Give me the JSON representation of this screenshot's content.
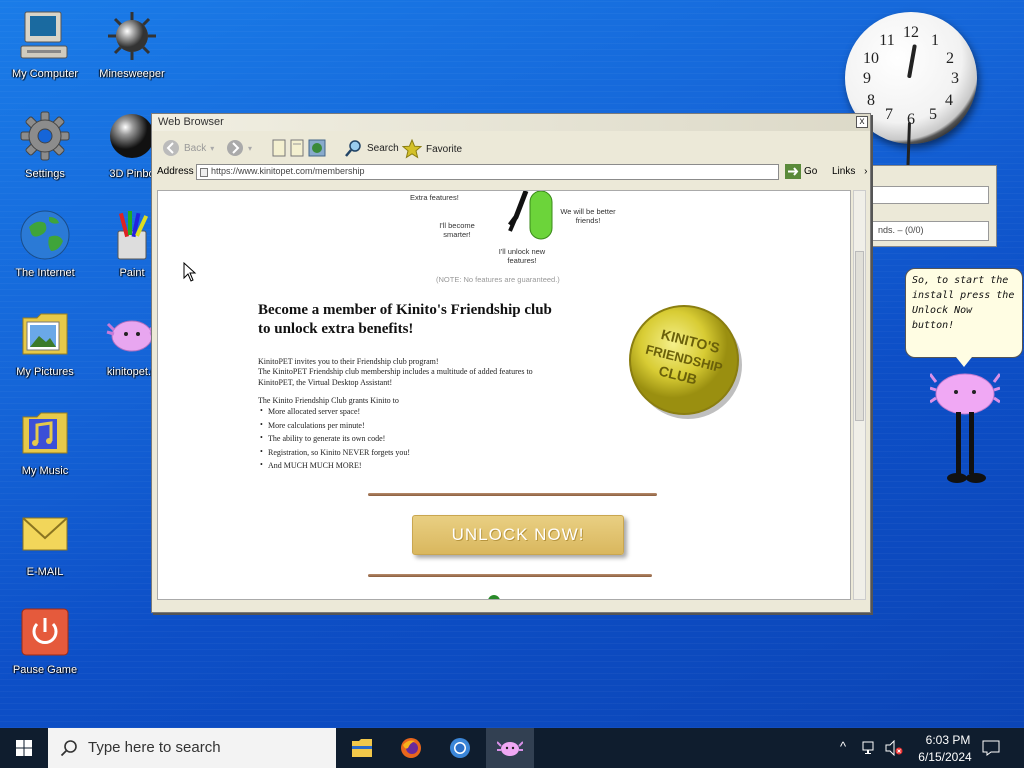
{
  "desktop_icons": [
    {
      "label": "My Computer",
      "icon": "computer-icon"
    },
    {
      "label": "Minesweeper",
      "icon": "mine-icon"
    },
    {
      "label": "Settings",
      "icon": "gear-icon"
    },
    {
      "label": "3D Pinbo",
      "icon": "pinball-icon"
    },
    {
      "label": "The Internet",
      "icon": "globe-icon"
    },
    {
      "label": "Paint",
      "icon": "paint-icon"
    },
    {
      "label": "My Pictures",
      "icon": "pictures-folder-icon"
    },
    {
      "label": "kinitopet.e",
      "icon": "kinito-icon"
    },
    {
      "label": "My Music",
      "icon": "music-folder-icon"
    },
    {
      "label": "E-MAIL",
      "icon": "envelope-icon"
    },
    {
      "label": "Pause Game",
      "icon": "power-icon"
    }
  ],
  "clock": {
    "numbers": [
      "12",
      "1",
      "2",
      "3",
      "4",
      "5",
      "6",
      "7",
      "8",
      "9",
      "10",
      "11"
    ]
  },
  "bg_window": {
    "field_text": "nds. – (0/0)"
  },
  "bubble": {
    "text": "So, to start the install press the Unlock Now button!"
  },
  "browser": {
    "title": "Web Browser",
    "close": "x",
    "toolbar": {
      "back": "Back",
      "search": "Search",
      "favorite": "Favorite"
    },
    "address_label": "Address",
    "address_value": "https://www.kinitopet.com/membership",
    "go": "Go",
    "links": "Links",
    "links_arrow": "›",
    "content": {
      "extra_features": "Extra features!",
      "become_smarter": "I'll become smarter!",
      "unlock_features": "I'll unlock new features!",
      "better_friends": "We will be better friends!",
      "note": "(NOTE: No features are guaranteed.)",
      "heading": "Become a member of Kinito's Friendship club to unlock extra benefits!",
      "para1": "KinitoPET invites you to their Friendship club program!",
      "para2": "The KinitoPET Friendship club membership includes a multitude of added features to KinitoPET, the Virtual Desktop Assistant!",
      "grants": "The Kinito Friendship Club grants Kinito to",
      "benefits": [
        "More allocated server space!",
        "More calculations per minute!",
        "The ability to generate its own code!",
        "Registration, so Kinito NEVER forgets you!",
        "And MUCH MUCH MORE!"
      ],
      "coin_lines": [
        "KINITO'S",
        "FRIENDSHIP",
        "CLUB"
      ],
      "unlock_button": "UNLOCK NOW!"
    }
  },
  "taskbar": {
    "search_placeholder": "Type here to search",
    "time": "6:03 PM",
    "date": "6/15/2024",
    "apps": [
      "file-explorer-icon",
      "firefox-icon",
      "chrome-icon",
      "kinito-icon"
    ]
  }
}
